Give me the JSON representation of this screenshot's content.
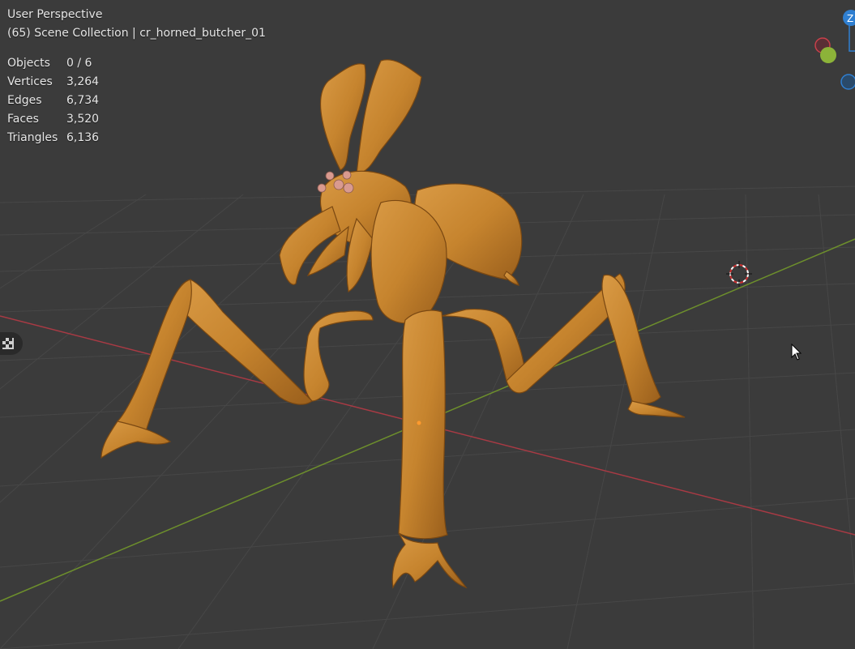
{
  "viewport": {
    "view_name": "User Perspective",
    "collection_path": "(65) Scene Collection | cr_horned_butcher_01"
  },
  "stats": [
    {
      "label": "Objects",
      "value": "0 / 6"
    },
    {
      "label": "Vertices",
      "value": "3,264"
    },
    {
      "label": "Edges",
      "value": "6,734"
    },
    {
      "label": "Faces",
      "value": "3,520"
    },
    {
      "label": "Triangles",
      "value": "6,136"
    }
  ],
  "gizmo": {
    "z_label": "Z",
    "colors": {
      "x": "#c8404a",
      "y": "#8cb339",
      "z": "#2f7fd1"
    }
  },
  "colors": {
    "background": "#3b3b3b",
    "grid": "#474747",
    "x_axis": "#a83a44",
    "y_axis": "#6d8f2c",
    "model_main": "#c6842e",
    "model_dark": "#8a5417"
  }
}
